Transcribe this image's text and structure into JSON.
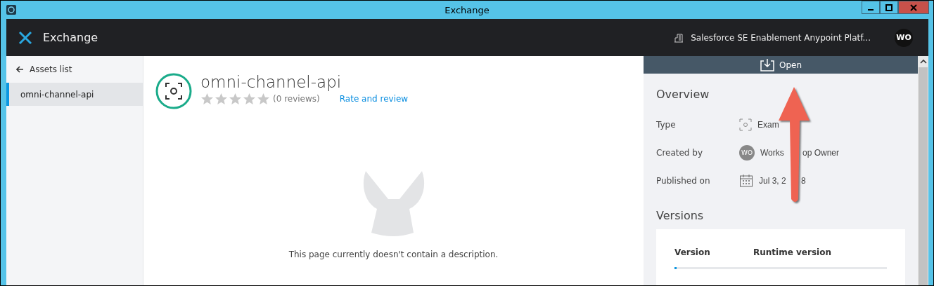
{
  "window": {
    "title": "Exchange"
  },
  "header": {
    "app_name": "Exchange",
    "organization": "Salesforce SE Enablement Anypoint Platf...",
    "avatar": "WO"
  },
  "sidebar": {
    "back_link": "Assets list",
    "items": [
      {
        "label": "omni-channel-api",
        "selected": true
      }
    ]
  },
  "asset": {
    "name": "omni-channel-api",
    "stars": 0,
    "reviews": "(0 reviews)",
    "rate_link": "Rate and review",
    "empty_message": "This page currently doesn't contain a description."
  },
  "panel": {
    "open_button": "Open",
    "overview_title": "Overview",
    "fields": [
      {
        "label": "Type",
        "kind": "type",
        "value_parts": [
          "Exam"
        ]
      },
      {
        "label": "Created by",
        "kind": "user",
        "avatar": "WO",
        "value_parts": [
          "Works",
          "op Owner"
        ]
      },
      {
        "label": "Published on",
        "kind": "date",
        "value_parts": [
          "Jul 3, 2",
          "8"
        ]
      }
    ],
    "versions_title": "Versions",
    "versions_columns": [
      "Version",
      "Runtime version"
    ]
  }
}
